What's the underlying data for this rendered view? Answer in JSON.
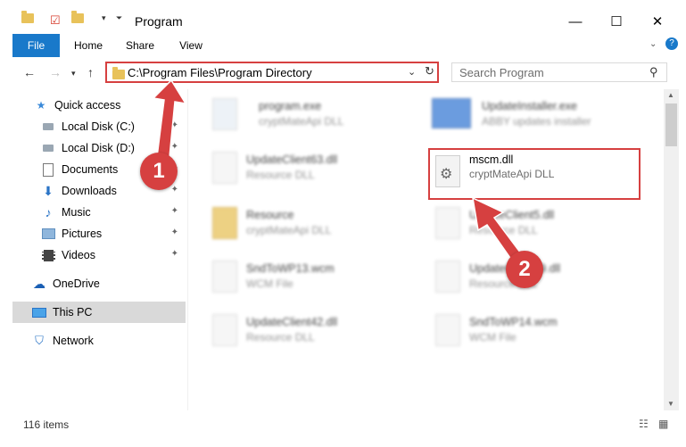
{
  "window": {
    "title": "Program"
  },
  "ribbon": {
    "tabs": [
      "File",
      "Home",
      "Share",
      "View"
    ]
  },
  "address": {
    "path": "C:\\Program Files\\Program Directory"
  },
  "search": {
    "placeholder": "Search Program"
  },
  "nav": {
    "items": [
      {
        "label": "Quick access",
        "icon": "star-icon"
      },
      {
        "label": "Local Disk (C:)",
        "icon": "drive-icon"
      },
      {
        "label": "Local Disk (D:)",
        "icon": "drive-icon"
      },
      {
        "label": "Documents",
        "icon": "documents-icon"
      },
      {
        "label": "Downloads",
        "icon": "download-arrow-icon"
      },
      {
        "label": "Music",
        "icon": "music-note-icon"
      },
      {
        "label": "Pictures",
        "icon": "pictures-icon"
      },
      {
        "label": "Videos",
        "icon": "film-icon"
      },
      {
        "label": "OneDrive",
        "icon": "cloud-icon"
      },
      {
        "label": "This PC",
        "icon": "monitor-icon"
      },
      {
        "label": "Network",
        "icon": "network-icon"
      }
    ]
  },
  "files": [
    {
      "name": "program.exe",
      "desc": "cryptMateApi DLL"
    },
    {
      "name": "UpdateInstaller.exe",
      "desc": "ABBY updates installer"
    },
    {
      "name": "UpdateClient63.dll",
      "desc": "Resource DLL"
    },
    {
      "name": "mscm.dll",
      "desc": "cryptMateApi DLL"
    },
    {
      "name": "Resource",
      "desc": "cryptMateApi DLL"
    },
    {
      "name": "UpdateClient5.dll",
      "desc": "Resource DLL"
    },
    {
      "name": "SndToWP13.wcm",
      "desc": "WCM File"
    },
    {
      "name": "UpdateClient19.dll",
      "desc": "Resource DLL"
    },
    {
      "name": "UpdateClient42.dll",
      "desc": "Resource DLL"
    },
    {
      "name": "SndToWP14.wcm",
      "desc": "WCM File"
    }
  ],
  "status": {
    "count": "116 items"
  },
  "annotations": {
    "step1": "1",
    "step2": "2"
  },
  "colors": {
    "accent": "#1979ca",
    "highlight": "#d64040"
  }
}
